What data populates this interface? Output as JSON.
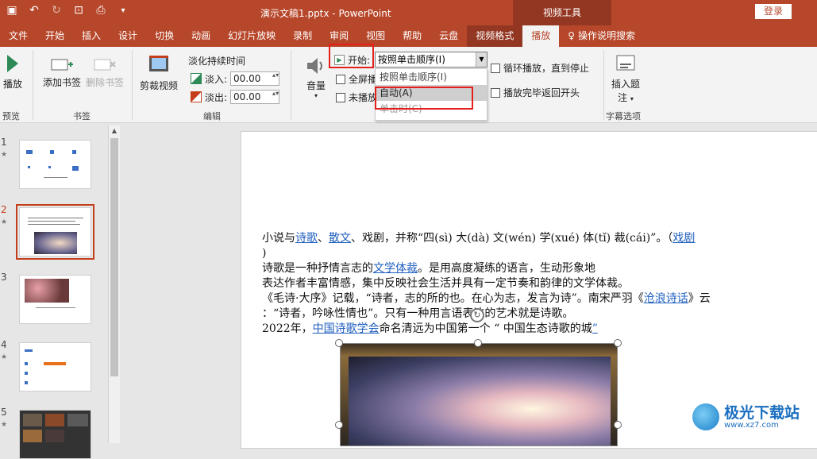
{
  "titlebar": {
    "title": "演示文稿1.pptx - PowerPoint",
    "contextual": "视频工具",
    "login": "登录"
  },
  "tabs": [
    "文件",
    "开始",
    "插入",
    "设计",
    "切换",
    "动画",
    "幻灯片放映",
    "录制",
    "审阅",
    "视图",
    "帮助",
    "云盘"
  ],
  "tab_video_format": "视频格式",
  "tab_playback": "播放",
  "tab_search": "操作说明搜索",
  "ribbon": {
    "play": "播放",
    "preview_group": "预览",
    "add_bookmark": "添加书签",
    "remove_bookmark": "删除书签",
    "bookmark_group": "书签",
    "trim_video": "剪裁视频",
    "fade_title": "淡化持续时间",
    "fade_in_label": "淡入:",
    "fade_in_value": "00.00",
    "fade_out_label": "淡出:",
    "fade_out_value": "00.00",
    "edit_group": "编辑",
    "volume": "音量",
    "start_label": "开始:",
    "start_value": "按照单击顺序(I)",
    "fullscreen": "全屏播",
    "hide_not_playing": "未播放",
    "loop": "循环播放，直到停止",
    "rewind": "播放完毕返回开头",
    "insert_caption_1": "插入题",
    "insert_caption_2": "注",
    "caption_group": "字幕选项"
  },
  "dropdown_options": [
    "按照单击顺序(I)",
    "自动(A)",
    "单击时(C)"
  ],
  "slides": [
    "1",
    "2",
    "3",
    "4",
    "5"
  ],
  "slide_text": {
    "l1a": "小说与",
    "l1b": "诗歌",
    "l1c": "、",
    "l1d": "散文",
    "l1e": "、戏剧，并称“四(sì) 大(dà) 文(wén) 学(xué) 体(tǐ) 裁(cái)”。（",
    "l1f": "戏剧",
    "l2": ")",
    "l3a": "诗歌是一种抒情言志的",
    "l3b": "文学体裁",
    "l3c": "。是用高度凝练的语言，生动形象地",
    "l4": "表达作者丰富情感，集中反映社会生活并具有一定节奏和韵律的文学体裁。",
    "l5a": "《毛诗·大序》记载，“诗者，志的所的也。在心为志，发言为诗”。南宋严羽《",
    "l5b": "沧浪诗话",
    "l5c": "》云",
    "l6": "：“诗者，吟咏性情也”。只有一种用言语表达的艺术就是诗歌。",
    "l7a": "2022年，",
    "l7b": "中国诗歌学会",
    "l7c": "命名清远为中国第一个 “ 中国生态诗歌的城",
    "l7d": "”"
  },
  "watermark": {
    "name": "极光下载站",
    "url": "www.xz7.com"
  },
  "colors": {
    "accent": "#b7472a",
    "highlight_box": "#e3201b"
  }
}
